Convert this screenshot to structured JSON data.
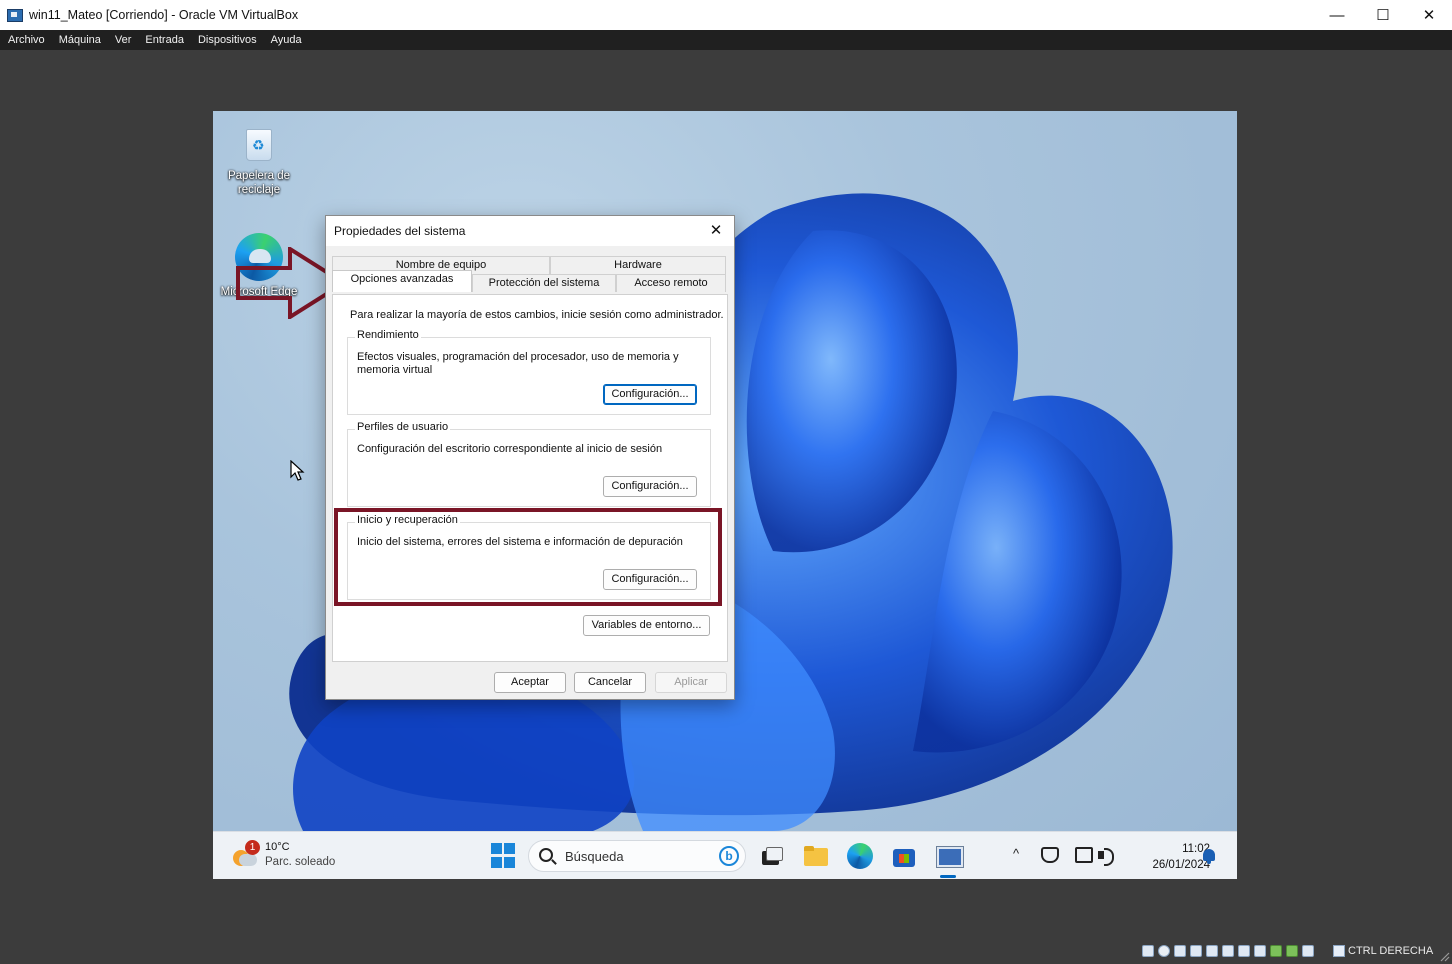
{
  "host": {
    "title": "win11_Mateo [Corriendo] - Oracle VM VirtualBox",
    "menu": [
      "Archivo",
      "Máquina",
      "Ver",
      "Entrada",
      "Dispositivos",
      "Ayuda"
    ],
    "window_controls": {
      "minimize": "—",
      "maximize": "☐",
      "close": "✕"
    },
    "status": {
      "host_key": "CTRL DERECHA",
      "icons": [
        "hard-disk-icon",
        "optical-drive-icon",
        "audio-icon",
        "network-icon",
        "usb-icon",
        "shared-folders-icon",
        "display-icon",
        "recording-icon",
        "cpu-icon",
        "mouse-integration-icon",
        "keyboard-icon"
      ]
    }
  },
  "desktop": {
    "icons": [
      {
        "label": "Papelera de reciclaje",
        "icon": "recycle-bin-icon"
      },
      {
        "label": "Microsoft Edge",
        "icon": "edge-icon"
      }
    ]
  },
  "dialog": {
    "title": "Propiedades del sistema",
    "close": "✕",
    "tabs_top": [
      "Nombre de equipo",
      "Hardware"
    ],
    "tabs_bottom": [
      "Opciones avanzadas",
      "Protección del sistema",
      "Acceso remoto"
    ],
    "active_tab": "Opciones avanzadas",
    "intro": "Para realizar la mayoría de estos cambios, inicie sesión como administrador.",
    "groups": [
      {
        "title": "Rendimiento",
        "text": "Efectos visuales, programación del procesador, uso de memoria y memoria virtual",
        "button": "Configuración..."
      },
      {
        "title": "Perfiles de usuario",
        "text": "Configuración del escritorio correspondiente al inicio de sesión",
        "button": "Configuración..."
      },
      {
        "title": "Inicio y recuperación",
        "text": "Inicio del sistema, errores del sistema e información de depuración",
        "button": "Configuración..."
      }
    ],
    "env_button": "Variables de entorno...",
    "buttons": {
      "ok": "Aceptar",
      "cancel": "Cancelar",
      "apply": "Aplicar"
    }
  },
  "annotation": {
    "highlight_color": "#7a1526",
    "arrow_target": "Opciones avanzadas",
    "highlight_target": "Inicio y recuperación"
  },
  "taskbar": {
    "weather": {
      "temp": "10°C",
      "desc": "Parc. soleado",
      "badge": "1"
    },
    "search_placeholder": "Búsqueda",
    "bing_label": "b",
    "pinned": [
      "start-icon",
      "task-view-icon",
      "file-explorer-icon",
      "edge-icon",
      "store-icon",
      "system-properties-icon"
    ],
    "clock": {
      "time": "11:02",
      "date": "26/01/2024"
    },
    "tray_chevron": "^"
  }
}
